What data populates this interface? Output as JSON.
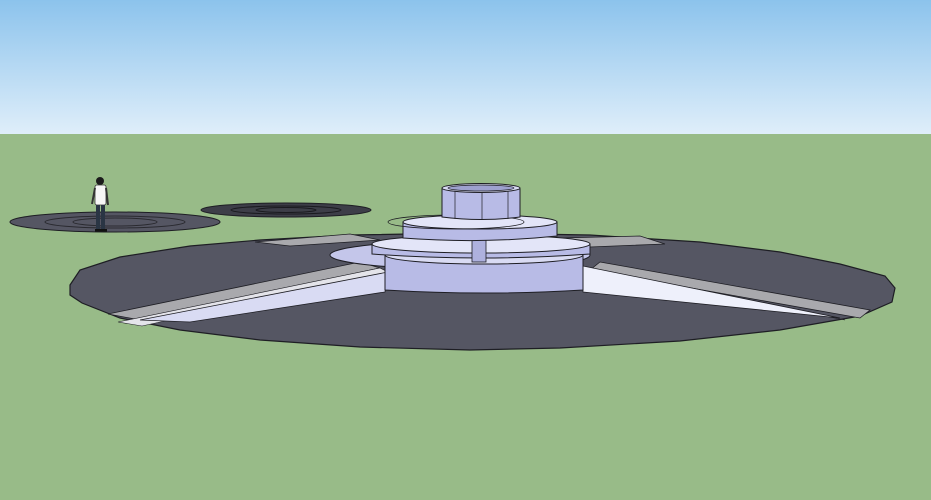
{
  "scene": {
    "sky_top_color": "#8cc3ec",
    "sky_bottom_color": "#dfeefa",
    "ground_color": "#98bb88",
    "platform_color": "#555663",
    "structure_light_color": "#d9dbf3",
    "structure_face_color": "#b8bbe6",
    "edge_color": "#1e1e24",
    "path_color": "#a9a9ad"
  }
}
